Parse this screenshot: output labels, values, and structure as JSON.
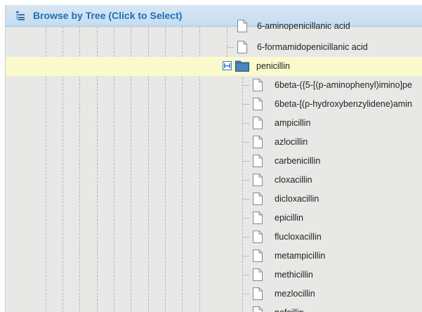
{
  "header": {
    "title": "Browse by Tree (Click to Select)",
    "icon": "tree-list-icon"
  },
  "tree": {
    "partial_top_label": "6-aminopenicillanic acid",
    "items": [
      {
        "label": "6-formamidopenicillanic acid",
        "level": "sibling",
        "type": "leaf",
        "icon": "document-icon"
      },
      {
        "label": "penicillin",
        "level": "sibling",
        "type": "folder",
        "expanded": true,
        "selected": true,
        "icon": "folder-icon"
      },
      {
        "label": "6beta-({5-[(p-aminophenyl)imino]pe",
        "level": "child",
        "type": "leaf",
        "icon": "document-icon"
      },
      {
        "label": "6beta-[(p-hydroxybenzylidene)amin",
        "level": "child",
        "type": "leaf",
        "icon": "document-icon"
      },
      {
        "label": "ampicillin",
        "level": "child",
        "type": "leaf",
        "icon": "document-icon"
      },
      {
        "label": "azlocillin",
        "level": "child",
        "type": "leaf",
        "icon": "document-icon"
      },
      {
        "label": "carbenicillin",
        "level": "child",
        "type": "leaf",
        "icon": "document-icon"
      },
      {
        "label": "cloxacillin",
        "level": "child",
        "type": "leaf",
        "icon": "document-icon"
      },
      {
        "label": "dicloxacillin",
        "level": "child",
        "type": "leaf",
        "icon": "document-icon"
      },
      {
        "label": "epicillin",
        "level": "child",
        "type": "leaf",
        "icon": "document-icon"
      },
      {
        "label": "flucloxacillin",
        "level": "child",
        "type": "leaf",
        "icon": "document-icon"
      },
      {
        "label": "metampicillin",
        "level": "child",
        "type": "leaf",
        "icon": "document-icon"
      },
      {
        "label": "methicillin",
        "level": "child",
        "type": "leaf",
        "icon": "document-icon"
      },
      {
        "label": "mezlocillin",
        "level": "child",
        "type": "leaf",
        "icon": "document-icon"
      },
      {
        "label": "nafcillin",
        "level": "child",
        "type": "leaf",
        "icon": "document-icon"
      }
    ]
  },
  "colors": {
    "header_text": "#1f6fb2",
    "selected_row": "#fafacc",
    "folder": "#3d74a8",
    "toggle": "#2f7bc0"
  }
}
